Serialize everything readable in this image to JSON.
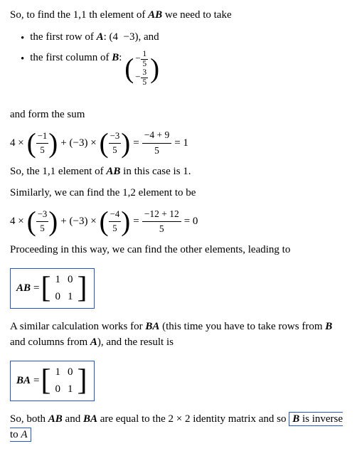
{
  "content": {
    "intro": "So, to find the 1,1 th element of",
    "AB_label": "AB",
    "intro2": "we need to take",
    "bullet1_pre": "the first row of",
    "bullet1_A": "A",
    "bullet1_post": ": (4  −3), and",
    "bullet2_pre": "the first column of",
    "bullet2_B": "B",
    "bullet2_post": ":",
    "form_sum": "and form the sum",
    "eq1_result": "= 1",
    "so_11": "So, the 1,1 element of",
    "so_11_AB": "AB",
    "so_11_post": "in this case is 1.",
    "similarly": "Similarly, we can find the 1,2 element to be",
    "eq2_result": "= 0",
    "proceeding": "Proceeding in this way, we can find the other elements, leading to",
    "AB_matrix_label": "AB",
    "BA_intro1": "A similar calculation works for",
    "BA_bold": "BA",
    "BA_intro2": "(this time you have to take rows from",
    "BA_B": "B",
    "BA_intro3": "and columns from",
    "BA_A": "A",
    "BA_intro4": "), and the result is",
    "BA_matrix_label": "BA",
    "conclusion1": "So, both",
    "conclusion_AB": "AB",
    "conclusion2": "and",
    "conclusion_BA": "BA",
    "conclusion3": "are equal to the 2 × 2 identity matrix and so",
    "conclusion_end": "B",
    "conclusion_end2": "is inverse to",
    "conclusion_end3": "A"
  }
}
